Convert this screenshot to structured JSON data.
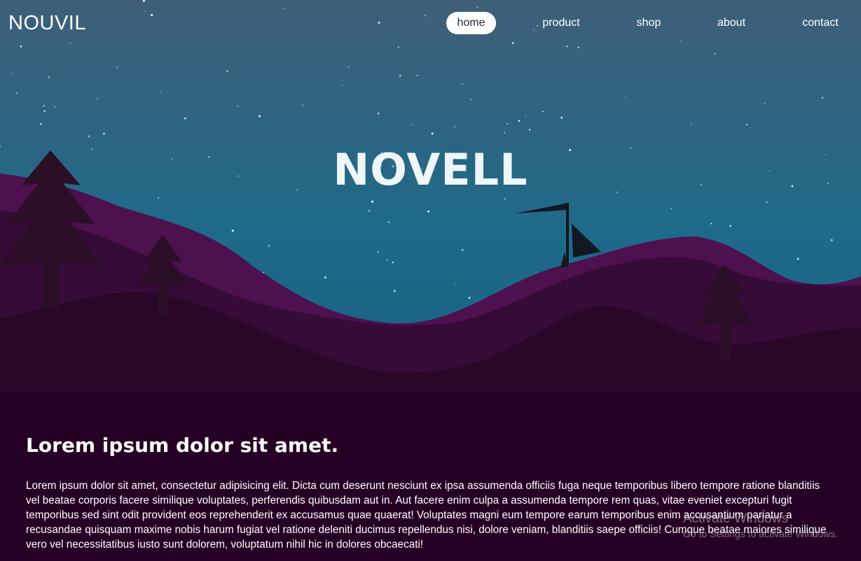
{
  "header": {
    "logo": "NOUVIL",
    "nav": [
      {
        "label": "home",
        "active": true
      },
      {
        "label": "product",
        "active": false
      },
      {
        "label": "shop",
        "active": false
      },
      {
        "label": "about",
        "active": false
      },
      {
        "label": "contact",
        "active": false
      }
    ]
  },
  "hero": {
    "title": "NOVELL"
  },
  "content": {
    "heading": "Lorem ipsum dolor sit amet.",
    "body": "Lorem ipsum dolor sit amet, consectetur adipisicing elit. Dicta cum deserunt nesciunt ex ipsa assumenda officiis fuga neque temporibus libero tempore ratione blanditiis vel beatae corporis facere similique voluptates, perferendis quibusdam aut in. Aut facere enim culpa a assumenda tempore rem quas, vitae eveniet excepturi fugit temporibus sed sint odit provident eos reprehenderit ex accusamus quae quaerat! Voluptates magni eum tempore earum temporibus enim accusantium pariatur a recusandae quisquam maxime nobis harum fugiat vel ratione deleniti ducimus repellendus nisi, dolore veniam, blanditiis saepe officiis! Cumque beatae maiores similique vero vel necessitatibus iusto sunt dolorem, voluptatum nihil hic in dolores obcaecati!"
  },
  "watermark": {
    "title": "Activate Windows",
    "subtitle": "Go to Settings to activate Windows."
  },
  "colors": {
    "sky_top": "#3e5f78",
    "sky_bottom": "#1e6a8a",
    "hills_back": "#4a0f4e",
    "hills_mid": "#330a33",
    "ground": "#260024",
    "accent_white": "#ffffff"
  }
}
